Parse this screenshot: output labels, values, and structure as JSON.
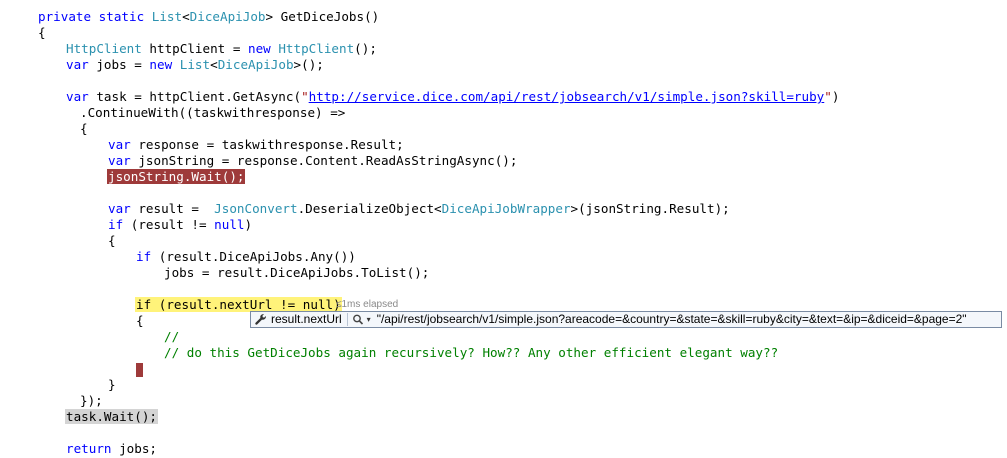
{
  "code": {
    "l1_kw": "private static ",
    "l1_type": "List",
    "l1_lt": "<",
    "l1_type2": "DiceApiJob",
    "l1_rest": "> GetDiceJobs()",
    "l2": "{",
    "l3_type": "HttpClient",
    "l3_mid": " httpClient = ",
    "l3_kw": "new ",
    "l3_type2": "HttpClient",
    "l3_end": "();",
    "l4_kw": "var",
    "l4_mid": " jobs = ",
    "l4_kw2": "new ",
    "l4_type": "List",
    "l4_lt": "<",
    "l4_type2": "DiceApiJob",
    "l4_end": ">();",
    "l6_kw": "var",
    "l6_mid": " task = httpClient.GetAsync(",
    "l6_q1": "\"",
    "l6_url": "http://service.dice.com/api/rest/jobsearch/v1/simple.json?skill=ruby",
    "l6_q2": "\"",
    "l6_end": ")",
    "l7": ".ContinueWith((taskwithresponse) =>",
    "l8": "{",
    "l9_kw": "var",
    "l9_rest": " response = taskwithresponse.Result;",
    "l10_kw": "var",
    "l10_rest": " jsonString = response.Content.ReadAsStringAsync();",
    "l11": "jsonString.Wait();",
    "l13_kw": "var",
    "l13_mid": " result =  ",
    "l13_type": "JsonConvert",
    "l13_mid2": ".DeserializeObject<",
    "l13_type2": "DiceApiJobWrapper",
    "l13_end": ">(jsonString.Result);",
    "l14_kw": "if",
    "l14_rest": " (result != ",
    "l14_kw2": "null",
    "l14_end": ")",
    "l15": "{",
    "l16_kw": "if",
    "l16_rest": " (result.DiceApiJobs.Any())",
    "l17": "jobs = result.DiceApiJobs.ToList();",
    "l19_a": "if (result.nextUrl != null)",
    "l20": "{",
    "l21": "//",
    "l22": "// do this GetDiceJobs again recursively? How?? Any other efficient elegant way??",
    "l24": "}",
    "l25": "});",
    "l26": "task.Wait();",
    "l28_kw": "return",
    "l28_rest": " jobs;"
  },
  "perf_tip": "≤1ms elapsed",
  "datatip": {
    "name": "result.nextUrl",
    "value": "\"/api/rest/jobsearch/v1/simple.json?areacode=&country=&state=&skill=ruby&city=&text=&ip=&diceid=&page=2\"",
    "icon_wrench": "wrench-icon",
    "icon_search": "magnifier-icon",
    "dropdown": "▾"
  },
  "colors": {
    "keyword": "#0000ff",
    "type": "#2b91af",
    "string": "#a31515",
    "comment": "#008000",
    "breakpoint": "#9e3a3a",
    "current_statement": "#fff37a"
  }
}
